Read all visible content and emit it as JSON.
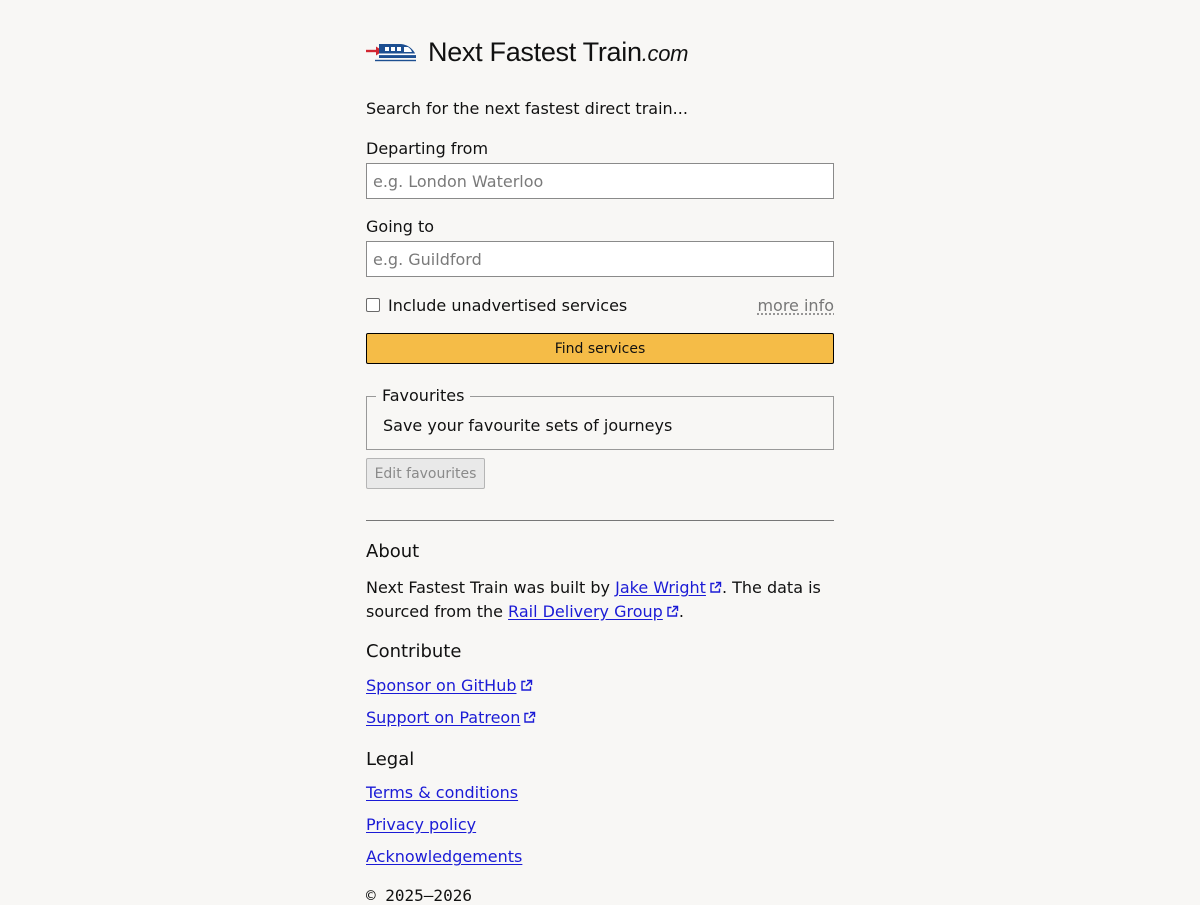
{
  "header": {
    "site_name": "Next Fastest Train",
    "site_tld": ".com"
  },
  "search": {
    "intro": "Search for the next fastest direct train...",
    "from_label": "Departing from",
    "from_placeholder": "e.g. London Waterloo",
    "from_value": "",
    "to_label": "Going to",
    "to_placeholder": "e.g. Guildford",
    "to_value": "",
    "unadvertised_label": "Include unadvertised services",
    "unadvertised_checked": false,
    "more_info": "more info",
    "submit_label": "Find services"
  },
  "favourites": {
    "legend": "Favourites",
    "text": "Save your favourite sets of journeys",
    "edit_label": "Edit favourites"
  },
  "about": {
    "heading": "About",
    "text_before": "Next Fastest Train was built by ",
    "author_link": "Jake Wright",
    "text_middle": ". The data is sourced from the ",
    "source_link": "Rail Delivery Group",
    "text_after": "."
  },
  "contribute": {
    "heading": "Contribute",
    "links": [
      "Sponsor on GitHub",
      "Support on Patreon"
    ]
  },
  "legal": {
    "heading": "Legal",
    "links": [
      "Terms & conditions",
      "Privacy policy",
      "Acknowledgements"
    ]
  },
  "footer": {
    "copyright": "© 2025–2026"
  },
  "colors": {
    "background": "#f8f7f5",
    "button_accent": "#f5bc47",
    "link": "#1b1bd6",
    "logo_red": "#d22630",
    "logo_blue": "#1d4f91"
  },
  "icons": {
    "logo": "train-logo-icon",
    "external": "external-link-icon"
  }
}
